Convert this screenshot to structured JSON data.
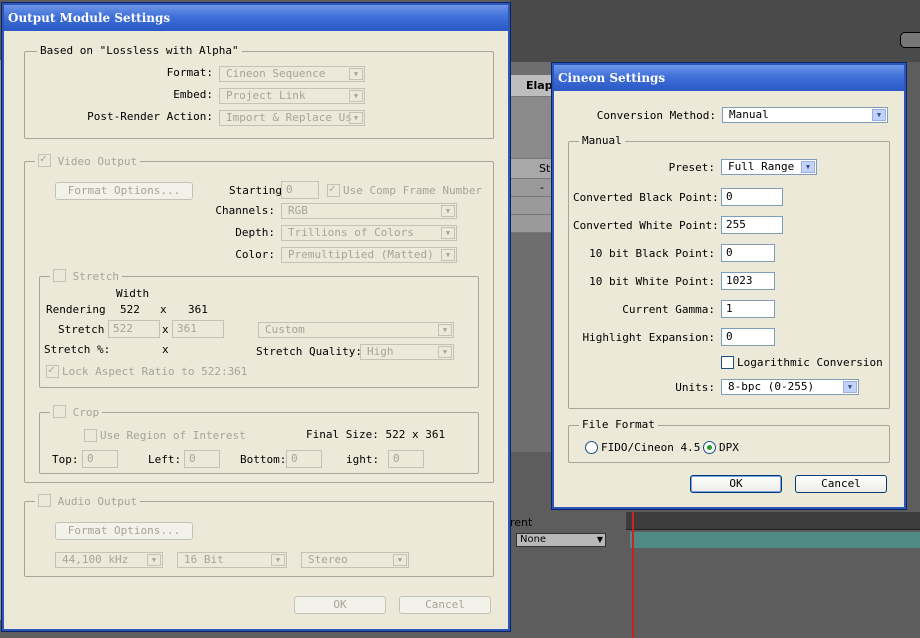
{
  "background": {
    "col_label_elapsed": "Elaps",
    "col_label_st": "St",
    "row_dash": "-",
    "timeline_label": "rent",
    "dropdown_value": "None"
  },
  "output_module": {
    "title": "Output Module Settings",
    "based_on": "Based on  \"Lossless with Alpha\"",
    "format_label": "Format:",
    "format_value": "Cineon Sequence",
    "embed_label": "Embed:",
    "embed_value": "Project Link",
    "post_render_label": "Post-Render Action:",
    "post_render_value": "Import & Replace Us",
    "video_output_label": "Video Output",
    "format_options_label": "Format Options...",
    "starting_label": "Starting",
    "starting_value": "0",
    "use_comp_frame_label": "Use Comp Frame Number",
    "channels_label": "Channels:",
    "channels_value": "RGB",
    "depth_label": "Depth:",
    "depth_value": "Trillions of Colors",
    "color_label": "Color:",
    "color_value": "Premultiplied (Matted)",
    "stretch_label": "Stretch",
    "width_header": "Width",
    "rendering_label": "Rendering",
    "rendering_width": "522",
    "times": "x",
    "rendering_height": "361",
    "stretch_row_label": "Stretch",
    "stretch_width": "522",
    "stretch_height": "361",
    "stretch_preset": "Custom",
    "stretch_percent_label": "Stretch %:",
    "stretch_quality_label": "Stretch Quality:",
    "stretch_quality_value": "High",
    "lock_aspect_label": "Lock Aspect Ratio to 522:361",
    "crop_label": "Crop",
    "use_roi_label": "Use Region of Interest",
    "final_size": "Final Size: 522 x 361",
    "top_label": "Top:",
    "top_value": "0",
    "left_label": "Left:",
    "left_value": "0",
    "bottom_label": "Bottom:",
    "bottom_value": "0",
    "right_label": "ight:",
    "right_value": "0",
    "audio_output_label": "Audio Output",
    "audio_format_options_label": "Format Options...",
    "sample_rate": "44,100 kHz",
    "bit_depth": "16 Bit",
    "channels_audio": "Stereo",
    "ok_label": "OK",
    "cancel_label": "Cancel"
  },
  "cineon": {
    "title": "Cineon Settings",
    "conversion_method_label": "Conversion Method:",
    "conversion_method_value": "Manual",
    "manual_group_label": "Manual",
    "preset_label": "Preset:",
    "preset_value": "Full Range",
    "black_point_label": "Converted Black Point:",
    "black_point_value": "0",
    "white_point_label": "Converted White Point:",
    "white_point_value": "255",
    "bit10_black_label": "10 bit Black Point:",
    "bit10_black_value": "0",
    "bit10_white_label": "10 bit White Point:",
    "bit10_white_value": "1023",
    "gamma_label": "Current Gamma:",
    "gamma_value": "1",
    "highlight_label": "Highlight Expansion:",
    "highlight_value": "0",
    "log_conversion_label": "Logarithmic Conversion",
    "units_label": "Units:",
    "units_value": "8-bpc (0-255)",
    "file_format_label": "File Format",
    "fido_label": "FIDO/Cineon 4.5",
    "dpx_label": "DPX",
    "ok_label": "OK",
    "cancel_label": "Cancel"
  },
  "colors": {
    "titlebar": "#2a58c6",
    "dialog_bg": "#ece9d8",
    "timeline_red": "#cc2222",
    "timeline_teal": "#4f8a85"
  }
}
